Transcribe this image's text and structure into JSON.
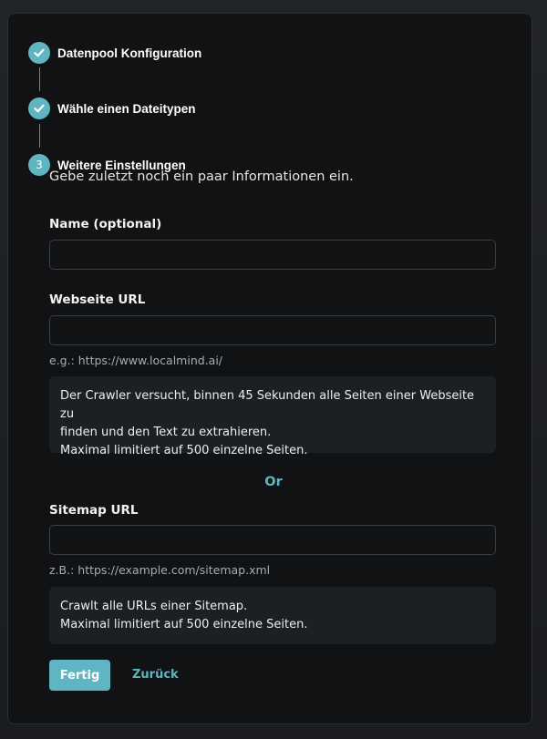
{
  "stepper": {
    "steps": [
      {
        "label": "Datenpool Konfiguration",
        "state": "done",
        "icon": "check-icon"
      },
      {
        "label": "Wähle einen Dateitypen",
        "state": "done",
        "icon": "check-icon"
      },
      {
        "label": "Weitere Einstellungen",
        "state": "active",
        "number": "3"
      }
    ]
  },
  "form": {
    "intro": "Gebe zuletzt noch ein paar Informationen ein.",
    "name_label": "Name (optional)",
    "name_value": "",
    "website_label": "Webseite URL",
    "website_value": "",
    "website_hint": "e.g.: https://www.localmind.ai/",
    "website_info": [
      "Der Crawler versucht, binnen 45 Sekunden alle Seiten einer Webseite zu",
      "finden und den Text zu extrahieren.",
      "Maximal limitiert auf 500 einzelne Seiten."
    ],
    "or_label": "Or",
    "sitemap_label": "Sitemap URL",
    "sitemap_value": "",
    "sitemap_hint": "z.B.: https://example.com/sitemap.xml",
    "sitemap_info": [
      "Crawlt alle URLs einer Sitemap.",
      "Maximal limitiert auf 500 einzelne Seiten."
    ]
  },
  "actions": {
    "finish_label": "Fertig",
    "back_label": "Zurück"
  },
  "colors": {
    "accent": "#5fb5c1",
    "panel": "#101213",
    "info_box": "#1d2023"
  }
}
